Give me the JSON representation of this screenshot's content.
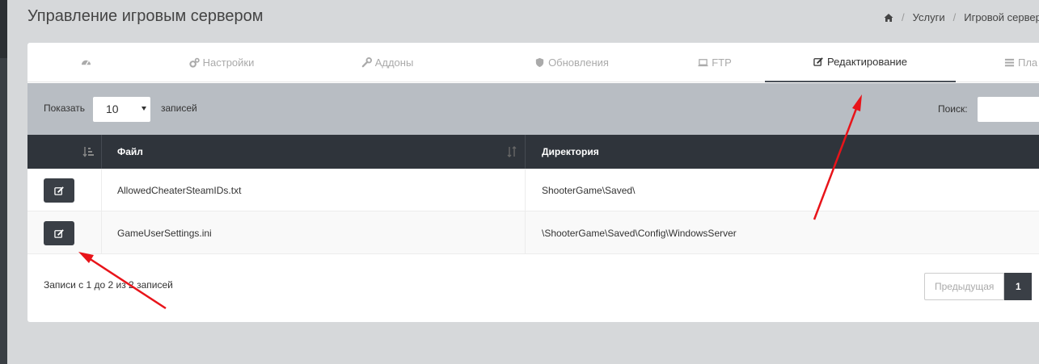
{
  "header": {
    "title": "Управление игровым сервером",
    "breadcrumb": [
      "Услуги",
      "Игровой сервер"
    ]
  },
  "tabs": [
    {
      "label": "",
      "icon": "dashboard-icon",
      "active": false
    },
    {
      "label": "Настройки",
      "icon": "cogs-icon",
      "active": false
    },
    {
      "label": "Аддоны",
      "icon": "wrench-icon",
      "active": false
    },
    {
      "label": "Обновления",
      "icon": "shield-icon",
      "active": false
    },
    {
      "label": "FTP",
      "icon": "laptop-icon",
      "active": false
    },
    {
      "label": "Редактирование",
      "icon": "edit-icon",
      "active": true
    },
    {
      "label": "Пла",
      "icon": "list-icon",
      "active": false
    }
  ],
  "toolbar": {
    "show_label": "Показать",
    "page_size": "10",
    "records_label": "записей",
    "search_label": "Поиск:",
    "search_value": ""
  },
  "table": {
    "columns": [
      "",
      "Файл",
      "Директория"
    ],
    "rows": [
      {
        "file": "AllowedCheaterSteamIDs.txt",
        "directory": "ShooterGame\\Saved\\"
      },
      {
        "file": "GameUserSettings.ini",
        "directory": "\\ShooterGame\\Saved\\Config\\WindowsServer"
      }
    ]
  },
  "footer": {
    "info": "Записи с 1 до 2 из 2 записей",
    "prev_label": "Предыдущая",
    "current_page": "1"
  },
  "colors": {
    "header_dark": "#2f343b",
    "toolbar": "#b8bdc3",
    "annotation_arrow": "#e8141a"
  }
}
